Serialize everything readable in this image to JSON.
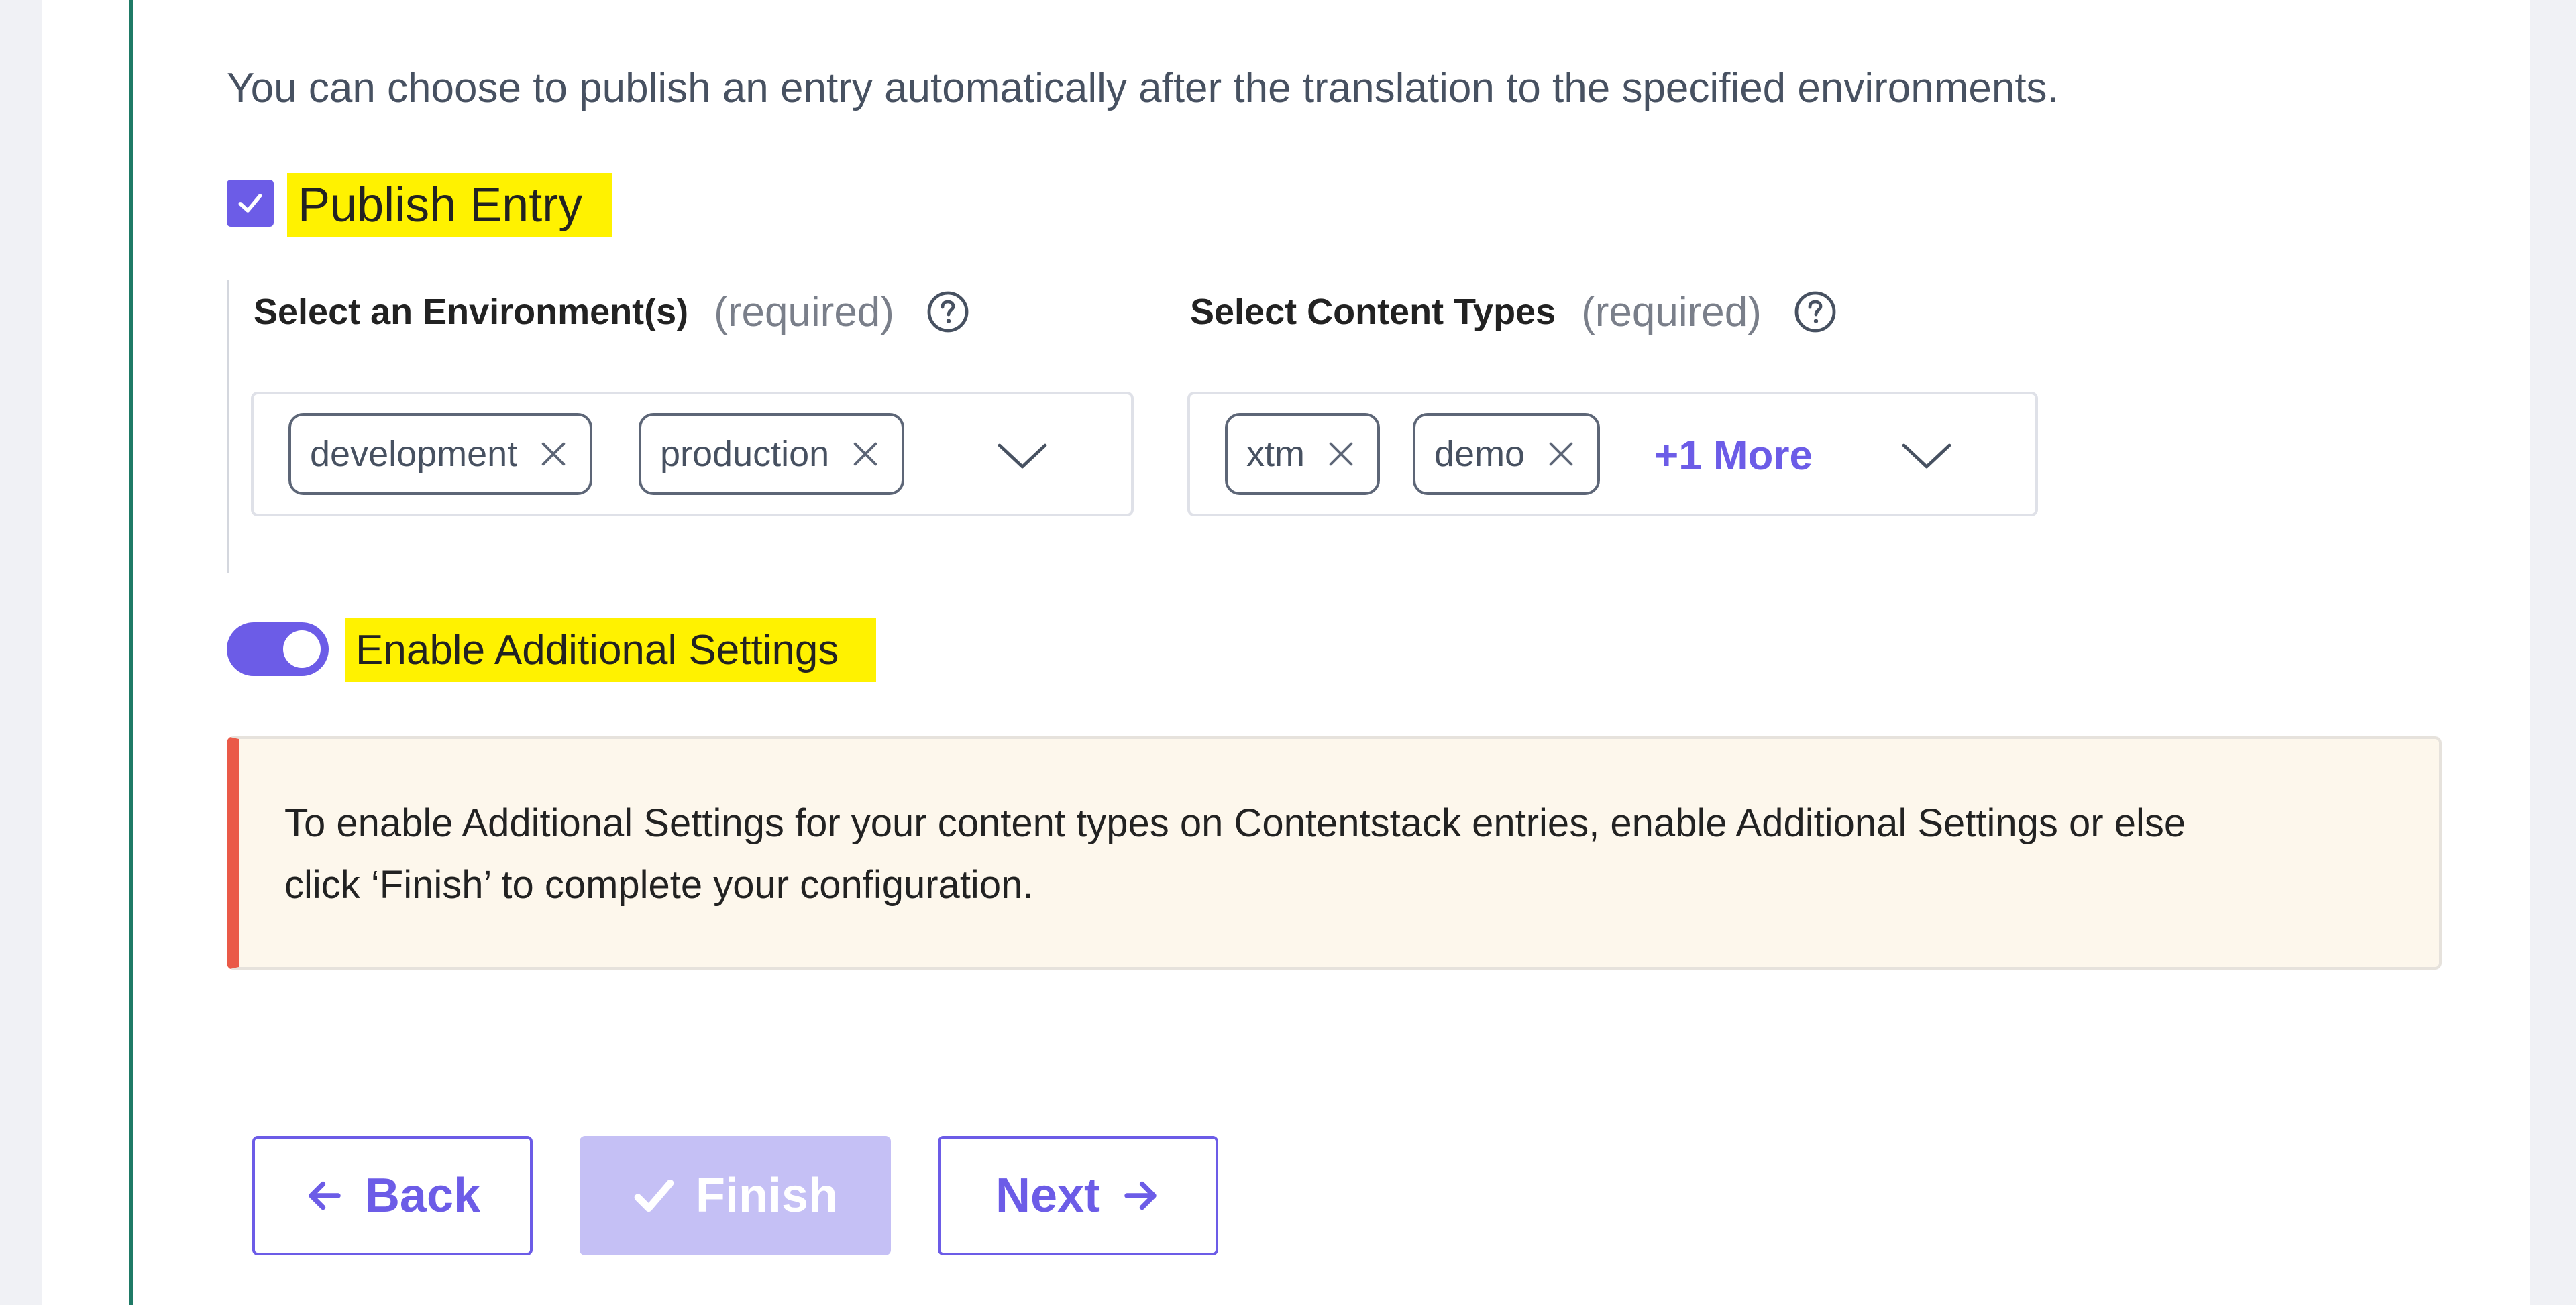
{
  "intro_text": "You can choose to publish an entry automatically after the translation to the specified environments.",
  "publish_entry": {
    "label": "Publish Entry",
    "checked": true
  },
  "environments": {
    "label": "Select an Environment(s)",
    "required_text": "(required)",
    "tags": [
      "development",
      "production"
    ]
  },
  "content_types": {
    "label": "Select Content Types",
    "required_text": "(required)",
    "tags": [
      "xtm",
      "demo"
    ],
    "more_text": "+1 More"
  },
  "additional_settings": {
    "label": "Enable Additional Settings",
    "enabled": true
  },
  "alert": {
    "line1": "To enable Additional Settings for your content types on Contentstack entries, enable Additional Settings or else",
    "line2": "click ‘Finish’ to complete your configuration."
  },
  "buttons": {
    "back": "Back",
    "finish": "Finish",
    "next": "Next"
  },
  "colors": {
    "accent": "#6c5ce7",
    "highlight": "#fff200",
    "alert_border": "#ea5a48",
    "alert_bg": "#fdf7ec",
    "side_line": "#1f7a66"
  },
  "icons": [
    "check-icon",
    "help-icon",
    "close-icon",
    "chevron-down-icon",
    "arrow-left-icon",
    "arrow-right-icon"
  ]
}
